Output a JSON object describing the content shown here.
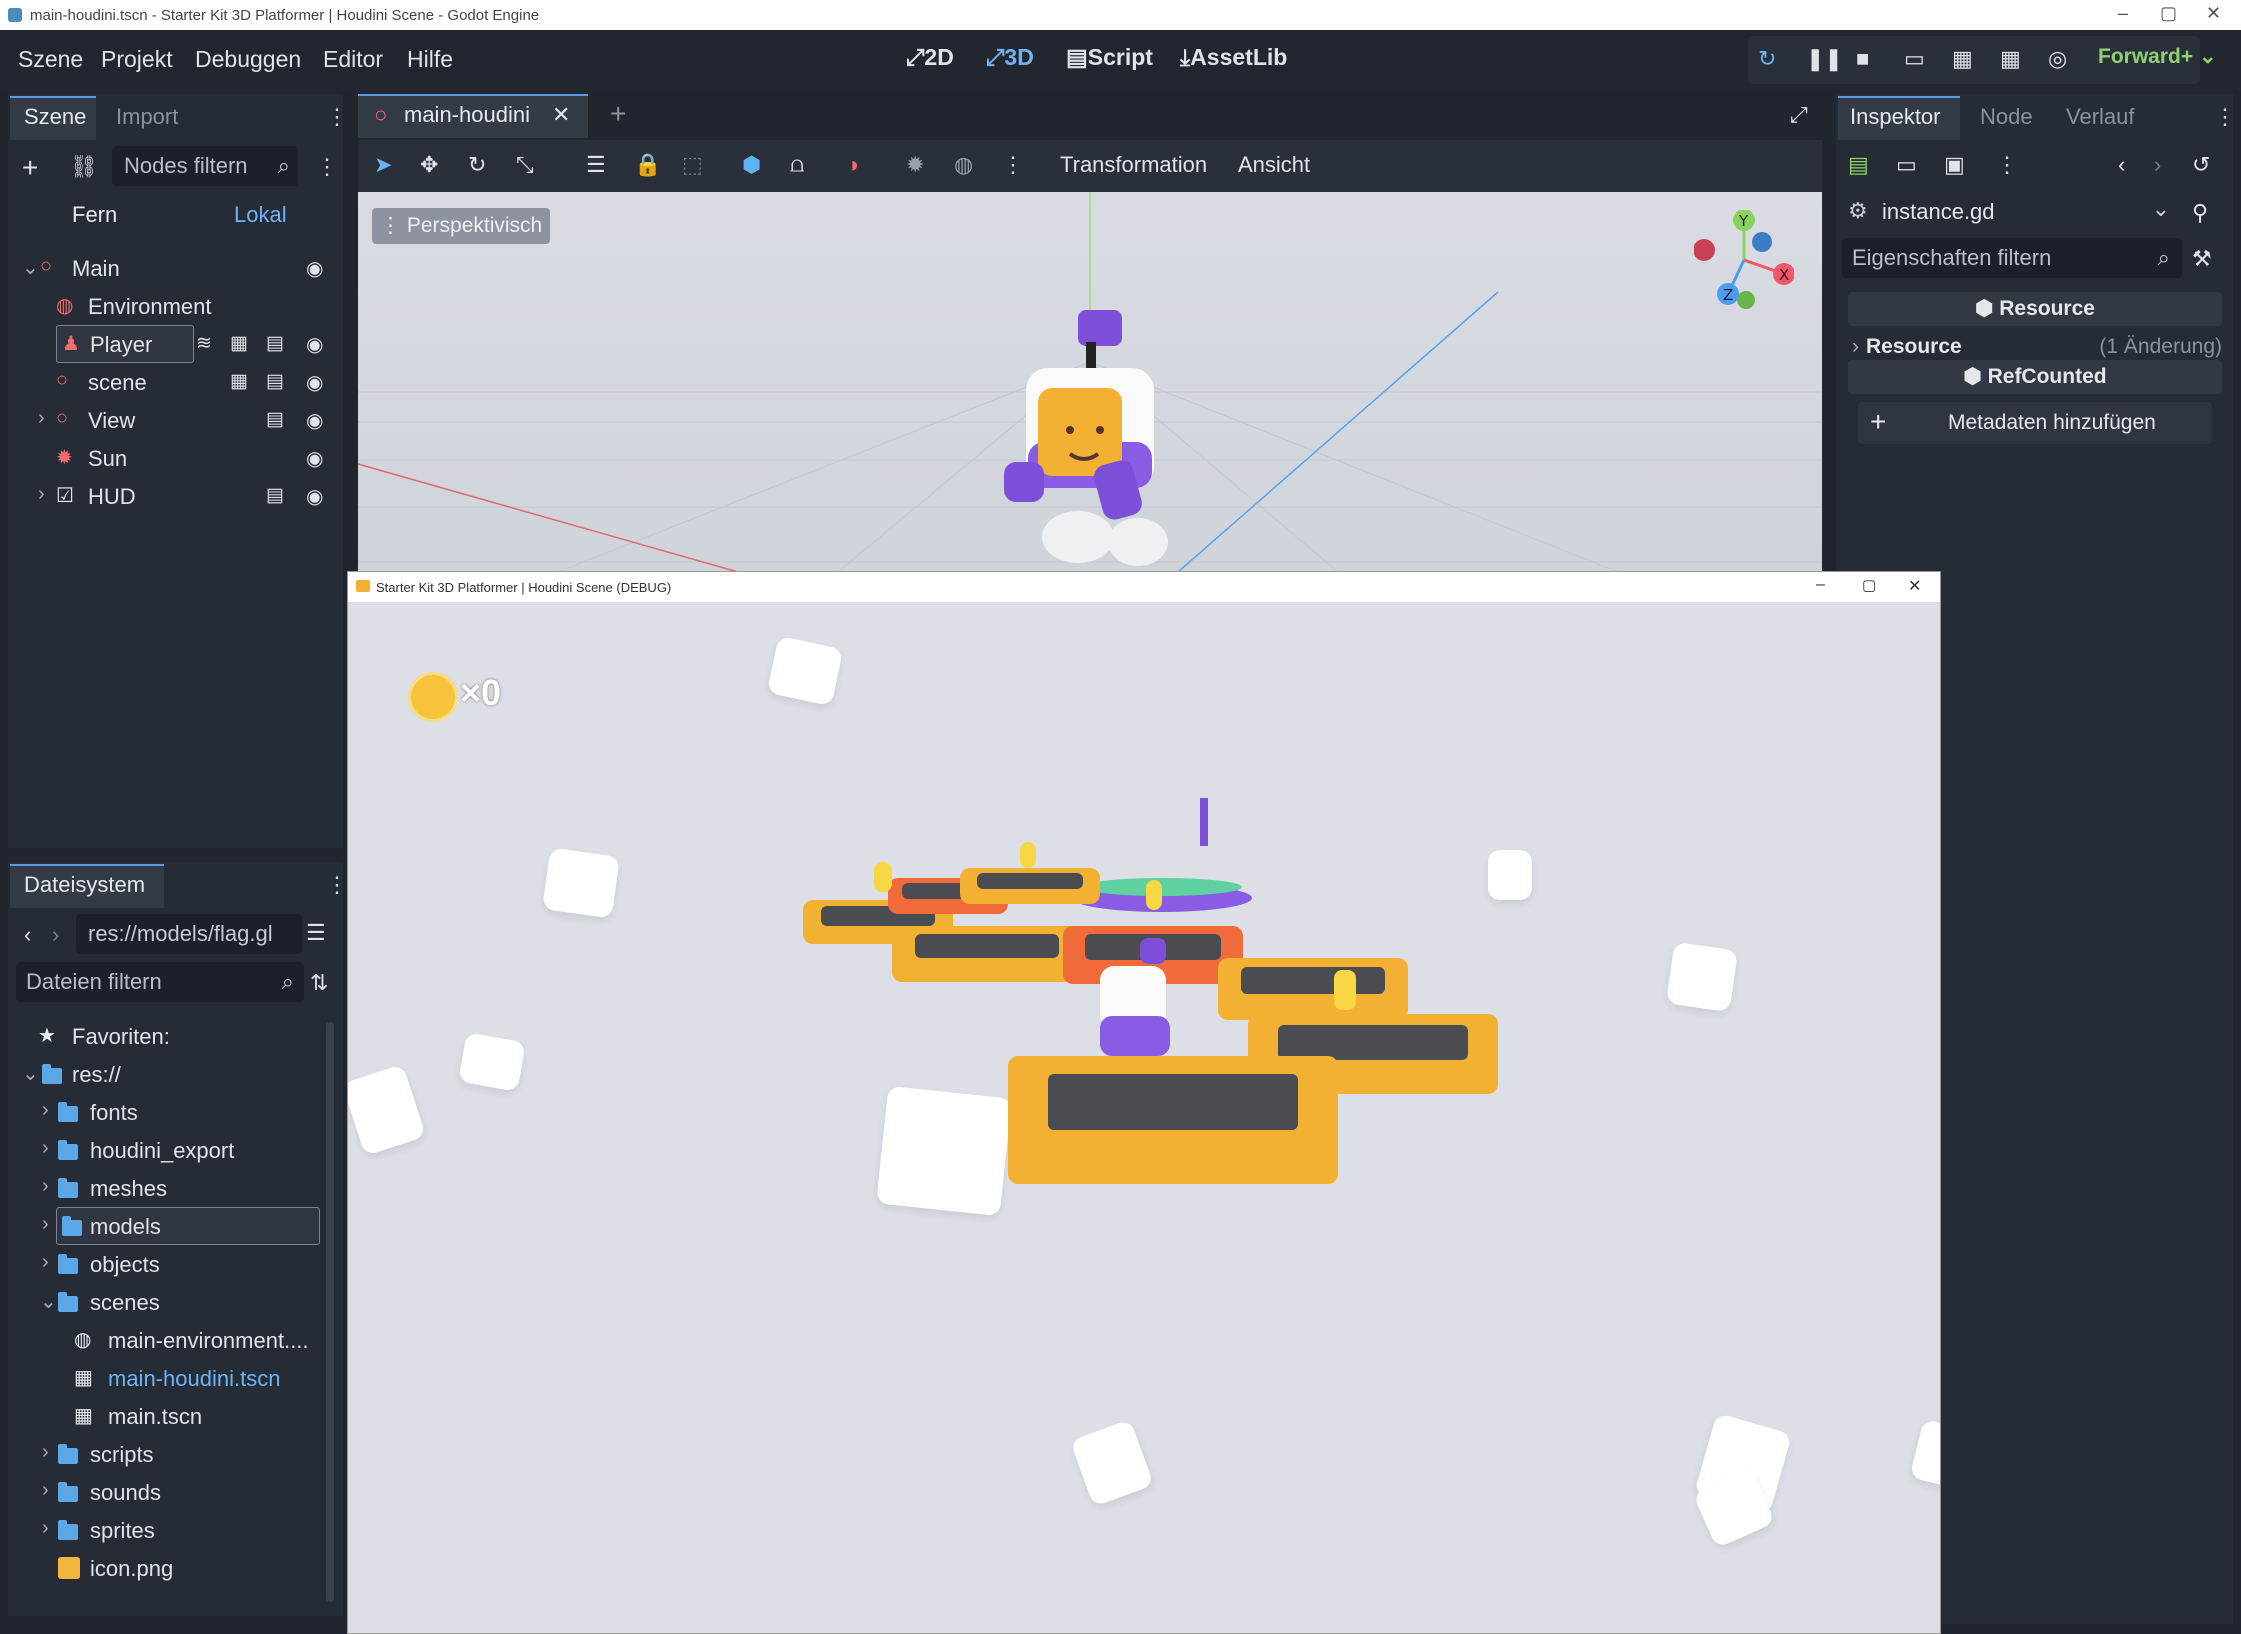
{
  "window": {
    "title": "main-houdini.tscn - Starter Kit 3D Platformer | Houdini Scene - Godot Engine"
  },
  "menu": {
    "items": [
      "Szene",
      "Projekt",
      "Debuggen",
      "Editor",
      "Hilfe"
    ]
  },
  "modes": {
    "two_d": "2D",
    "three_d": "3D",
    "script": "Script",
    "assetlib": "AssetLib"
  },
  "renderer": "Forward+",
  "scene_dock": {
    "tabs": [
      "Szene",
      "Import"
    ],
    "filter_placeholder": "Nodes filtern",
    "remote": "Fern",
    "local": "Lokal",
    "nodes": [
      "Main",
      "Environment",
      "Player",
      "scene",
      "View",
      "Sun",
      "HUD"
    ]
  },
  "filesystem": {
    "tab": "Dateisystem",
    "path": "res://models/flag.gl",
    "filter_placeholder": "Dateien filtern",
    "favorites": "Favoriten:",
    "root": "res://",
    "items": [
      "fonts",
      "houdini_export",
      "meshes",
      "models",
      "objects",
      "scenes",
      "main-environment....",
      "main-houdini.tscn",
      "main.tscn",
      "scripts",
      "sounds",
      "sprites",
      "icon.png"
    ]
  },
  "editor": {
    "tab": "main-houdini",
    "toolbar": {
      "transform": "Transformation",
      "view": "Ansicht"
    },
    "perspective": "Perspektivisch",
    "gizmo": {
      "x": "X",
      "y": "Y",
      "z": "Z"
    }
  },
  "debug_window": {
    "title": "Starter Kit 3D Platformer | Houdini Scene (DEBUG)",
    "coin_count": "×0"
  },
  "inspector": {
    "tabs": [
      "Inspektor",
      "Node",
      "Verlauf"
    ],
    "resource": "instance.gd",
    "filter_placeholder": "Eigenschaften filtern",
    "section_resource": "Resource",
    "resource_prop": "Resource",
    "resource_changes": "(1 Änderung)",
    "section_refcounted": "RefCounted",
    "add_metadata": "Metadaten hinzufügen"
  }
}
